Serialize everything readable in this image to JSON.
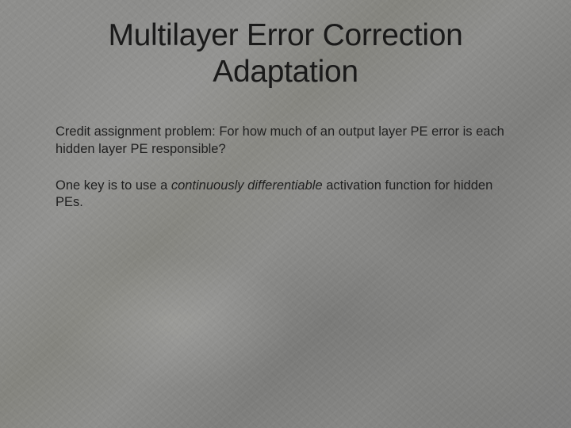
{
  "title_line1": "Multilayer Error Correction",
  "title_line2": "Adaptation",
  "para1": "Credit assignment problem:  For how much of an output layer PE error is each hidden layer PE responsible?",
  "para2_a": "One key is to use a ",
  "para2_emph": "continuously differentiable",
  "para2_b": " activation function for hidden PEs."
}
